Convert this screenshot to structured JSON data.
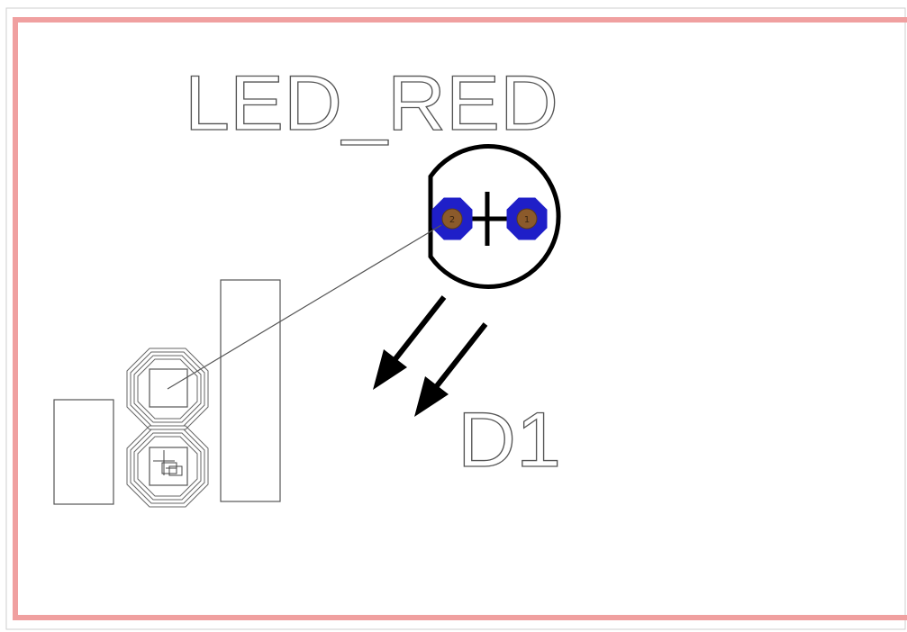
{
  "component": {
    "value_label": "LED_RED",
    "reference_label": "D1"
  },
  "pads": {
    "led_pad_1": "1",
    "led_pad_2": "2"
  },
  "colors": {
    "board_outline": "#f0a0a0",
    "pad_copper": "#1f1fc8",
    "drill_hole": "#8b5a2b",
    "silkscreen": "#000000",
    "outline_text": "#555555",
    "ratsnest": "#555555",
    "canvas": "#ffffff"
  }
}
